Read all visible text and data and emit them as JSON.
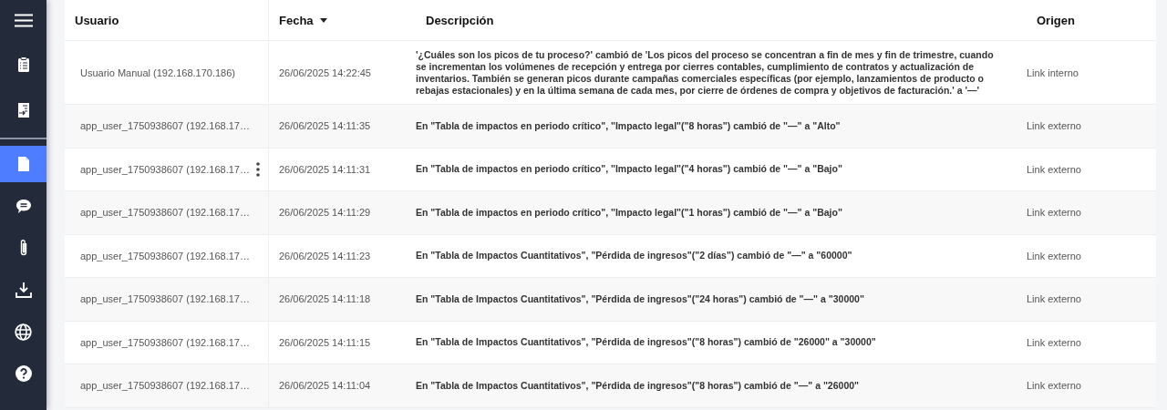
{
  "sidebar": {
    "items": [
      {
        "kind": "clipboard",
        "selected": false
      },
      {
        "kind": "document-arrow",
        "selected": false
      },
      {
        "kind": "file",
        "selected": true
      },
      {
        "kind": "chat",
        "selected": false
      },
      {
        "kind": "clip",
        "selected": false
      },
      {
        "kind": "download",
        "selected": false
      },
      {
        "kind": "globe",
        "selected": false
      },
      {
        "kind": "help",
        "selected": false
      }
    ]
  },
  "table": {
    "columns": [
      {
        "label": "Usuario",
        "sorted": false
      },
      {
        "label": "Fecha",
        "sorted": true
      },
      {
        "label": "Descripción",
        "sorted": false
      },
      {
        "label": "Origen",
        "sorted": false
      }
    ],
    "rows": [
      {
        "user": "Usuario Manual (192.168.170.186)",
        "date": "26/06/2025 14:22:45",
        "description": "'¿Cuáles son los picos de tu proceso?' cambió de 'Los picos del proceso se concentran a fin de mes y fin de trimestre, cuando se incrementan los volúmenes de recepción y entrega por cierres contables, cumplimiento de contratos y actualización de inventarios. También se generan picos durante campañas comerciales específicas (por ejemplo, lanzamientos de producto o rebajas estacionales) y en la última semana de cada mes, por cierre de órdenes de compra y objetivos de facturación.' a '—'",
        "origin": "Link interno",
        "menu": false
      },
      {
        "user": "app_user_1750938607 (192.168.17…",
        "date": "26/06/2025 14:11:35",
        "description": "En \"Tabla de impactos en periodo crítico\", \"Impacto legal\"(\"8 horas\") cambió de \"—\" a \"Alto\"",
        "origin": "Link externo",
        "menu": false
      },
      {
        "user": "app_user_1750938607 (192.168.17…",
        "date": "26/06/2025 14:11:31",
        "description": "En \"Tabla de impactos en periodo crítico\", \"Impacto legal\"(\"4 horas\") cambió de \"—\" a \"Bajo\"",
        "origin": "Link externo",
        "menu": true
      },
      {
        "user": "app_user_1750938607 (192.168.17…",
        "date": "26/06/2025 14:11:29",
        "description": "En \"Tabla de impactos en periodo crítico\", \"Impacto legal\"(\"1 horas\") cambió de \"—\" a \"Bajo\"",
        "origin": "Link externo",
        "menu": false
      },
      {
        "user": "app_user_1750938607 (192.168.17…",
        "date": "26/06/2025 14:11:23",
        "description": "En \"Tabla de Impactos Cuantitativos\", \"Pérdida de ingresos\"(\"2 días\") cambió de \"—\" a \"60000\"",
        "origin": "Link externo",
        "menu": false
      },
      {
        "user": "app_user_1750938607 (192.168.17…",
        "date": "26/06/2025 14:11:18",
        "description": "En \"Tabla de Impactos Cuantitativos\", \"Pérdida de ingresos\"(\"24 horas\") cambió de \"—\" a \"30000\"",
        "origin": "Link externo",
        "menu": false
      },
      {
        "user": "app_user_1750938607 (192.168.17…",
        "date": "26/06/2025 14:11:15",
        "description": "En \"Tabla de Impactos Cuantitativos\", \"Pérdida de ingresos\"(\"8 horas\") cambió de \"26000\" a \"30000\"",
        "origin": "Link externo",
        "menu": false
      },
      {
        "user": "app_user_1750938607 (192.168.17…",
        "date": "26/06/2025 14:11:04",
        "description": "En \"Tabla de Impactos Cuantitativos\", \"Pérdida de ingresos\"(\"8 horas\") cambió de \"—\" a \"26000\"",
        "origin": "Link externo",
        "menu": false
      }
    ]
  }
}
